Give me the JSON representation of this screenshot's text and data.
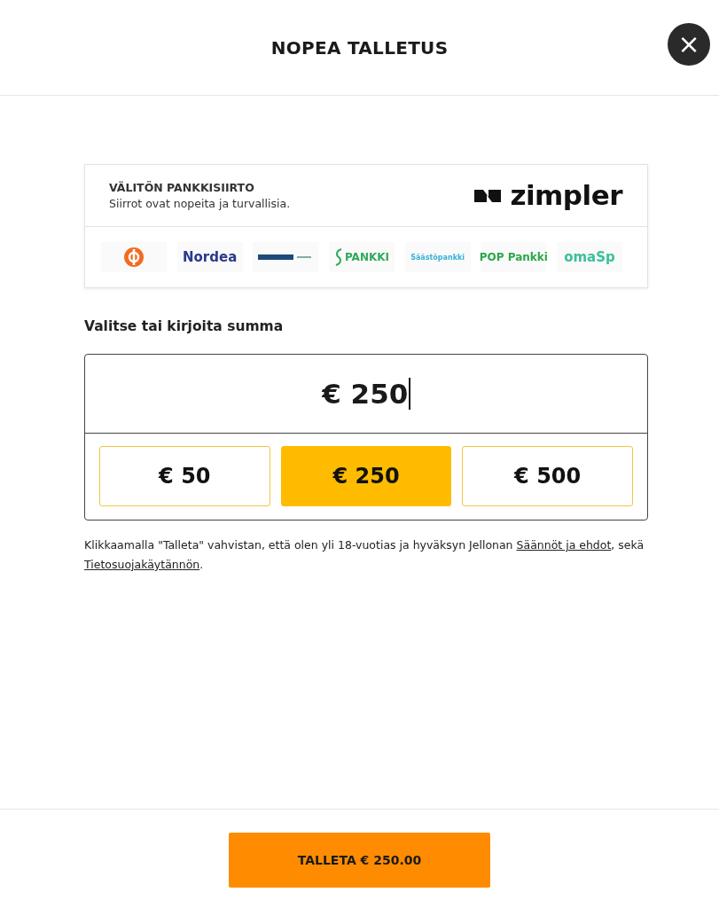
{
  "header": {
    "title": "NOPEA TALLETUS",
    "close": "×"
  },
  "provider": {
    "title": "VÄLITÖN PANKKISIIRTO",
    "subtitle": "Siirrot ovat nopeita ja turvallisia.",
    "logo": "zimpler"
  },
  "banks": [
    {
      "kind": "op"
    },
    {
      "kind": "text",
      "label": "Nordea",
      "color": "#2a3a8c"
    },
    {
      "kind": "bar"
    },
    {
      "kind": "s",
      "label": "PANKKI",
      "color": "#2faa5a"
    },
    {
      "kind": "text",
      "label": "Säästöpankki",
      "color": "#3ab0d8"
    },
    {
      "kind": "text",
      "label": "POP Pankki",
      "color": "#2aa84a"
    },
    {
      "kind": "text",
      "label": "omaSp",
      "color": "#3cc09a"
    }
  ],
  "amount_label": "Valitse tai kirjoita summa",
  "amount_value": "€ 250",
  "options": [
    {
      "label": "€ 50",
      "selected": false
    },
    {
      "label": "€ 250",
      "selected": true
    },
    {
      "label": "€ 500",
      "selected": false
    }
  ],
  "consent": [
    {
      "kind": "text",
      "text": "Klikkaamalla \"Talleta\" vahvistan, että olen yli 18-vuotias ja hyväksyn Jellonan "
    },
    {
      "kind": "link",
      "text": "Säännöt ja ehdot"
    },
    {
      "kind": "text",
      "text": ", sekä "
    },
    {
      "kind": "link",
      "text": "Tietosuojakäytännön"
    },
    {
      "kind": "text",
      "text": "."
    }
  ],
  "submit": "TALLETA € 250.00"
}
